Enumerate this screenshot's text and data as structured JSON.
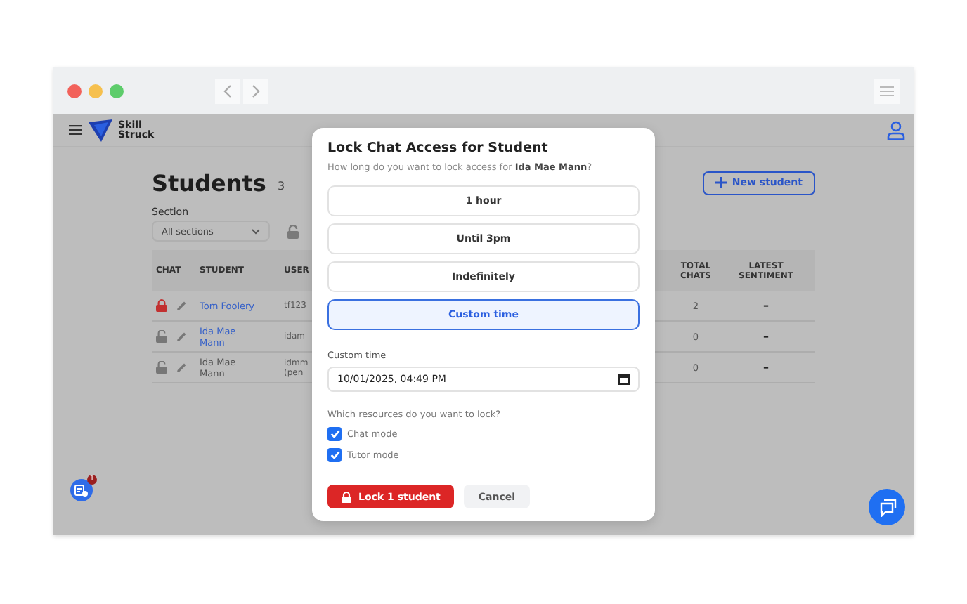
{
  "app": {
    "logo_text": [
      "Skill",
      "Struck"
    ]
  },
  "page": {
    "title": "Students",
    "count": "3",
    "section_label": "Section",
    "section_value": "All sections",
    "new_student": "New student"
  },
  "table": {
    "columns": [
      "CHAT",
      "STUDENT",
      "USER",
      "TOTAL CHATS",
      "LATEST SENTIMENT"
    ],
    "rows": [
      {
        "locked": true,
        "student": "Tom Foolery",
        "link": true,
        "username": "tf123",
        "total_chats": "2",
        "sentiment": "–"
      },
      {
        "locked": false,
        "student": "Ida Mae Mann",
        "link": true,
        "username": "idam",
        "total_chats": "0",
        "sentiment": "–"
      },
      {
        "locked": false,
        "student": "Ida Mae Mann",
        "link": false,
        "username": "idmm (pen",
        "total_chats": "0",
        "sentiment": "–"
      }
    ]
  },
  "notification_badge": "1",
  "modal": {
    "title": "Lock Chat Access for Student",
    "subtitle": "How long do you want to lock access for **Ida Mae Mann**?",
    "options": [
      {
        "label": "1 hour",
        "selected": false
      },
      {
        "label": "Until 3pm",
        "selected": false
      },
      {
        "label": "Indefinitely",
        "selected": false
      },
      {
        "label": "Custom time",
        "selected": true
      }
    ],
    "custom_time_label": "Custom time",
    "custom_time_value": "10/01/2025, 04:49 PM",
    "resources_question": "Which resources do you want to lock?",
    "resources": [
      {
        "label": "Chat mode",
        "checked": true
      },
      {
        "label": "Tutor mode",
        "checked": true
      }
    ],
    "primary_button": "Lock 1 student",
    "secondary_button": "Cancel"
  }
}
